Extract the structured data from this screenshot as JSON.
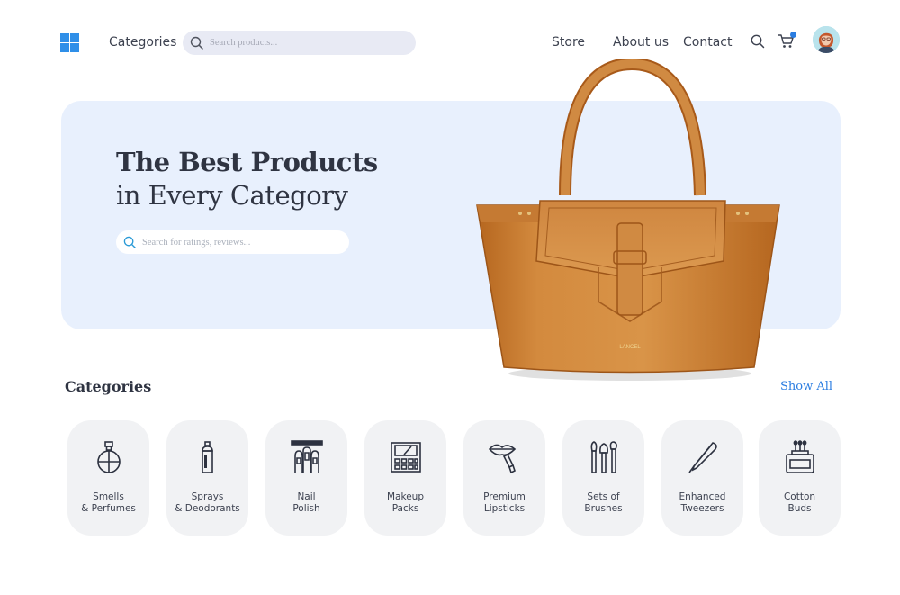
{
  "header": {
    "nav": {
      "categories": "Categories",
      "store": "Store",
      "about": "About us",
      "contact": "Contact"
    },
    "search_placeholder": "Search products...",
    "icons": [
      "windows-logo-icon",
      "search-icon",
      "cart-icon",
      "avatar"
    ],
    "accent_color": "#2a7de1"
  },
  "hero": {
    "title_line1": "The Best Products",
    "title_line2": "in Every Category",
    "search_placeholder": "Search for ratings, reviews...",
    "background": "#e8f0fd",
    "bag_brand": "LANCEL"
  },
  "categories": {
    "title": "Categories",
    "show_all": "Show All",
    "items": [
      {
        "label": "Smells\n& Perfumes",
        "icon": "perfume-icon"
      },
      {
        "label": "Sprays\n& Deodorants",
        "icon": "spray-icon"
      },
      {
        "label": "Nail\nPolish",
        "icon": "nail-polish-icon"
      },
      {
        "label": "Makeup\nPacks",
        "icon": "makeup-palette-icon"
      },
      {
        "label": "Premium\nLipsticks",
        "icon": "lipstick-icon"
      },
      {
        "label": "Sets of\nBrushes",
        "icon": "brushes-icon"
      },
      {
        "label": "Enhanced\nTweezers",
        "icon": "tweezers-icon"
      },
      {
        "label": "Cotton\nBuds",
        "icon": "cotton-buds-icon"
      }
    ]
  }
}
